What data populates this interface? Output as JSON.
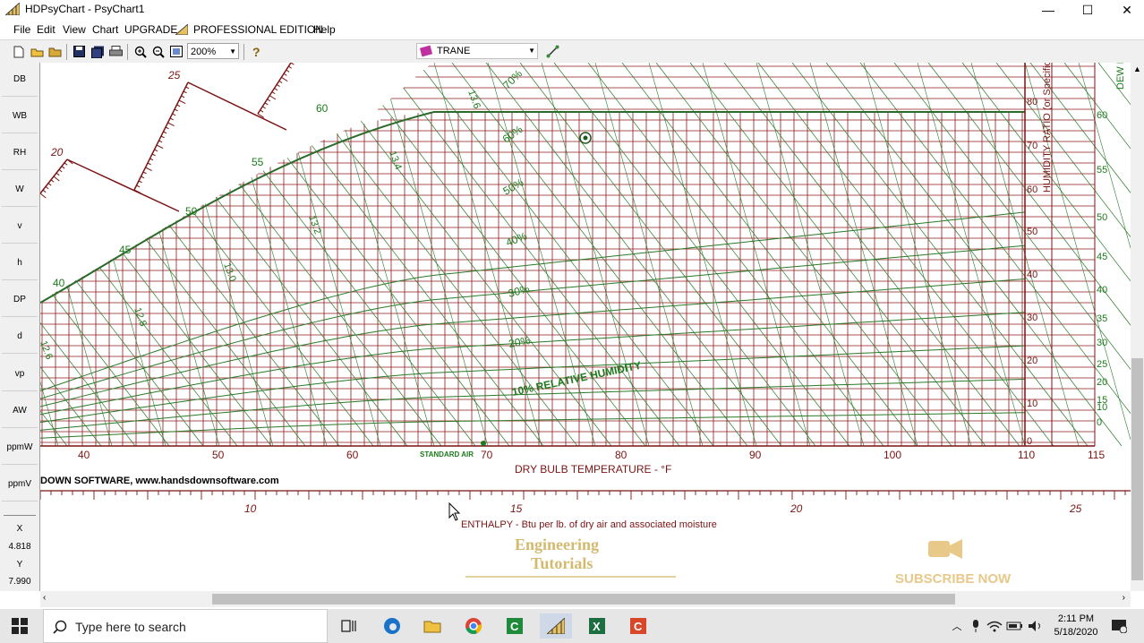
{
  "window": {
    "title": "HDPsyChart - PsyChart1",
    "minimize": "—",
    "maximize": "☐",
    "close": "✕"
  },
  "menu": [
    {
      "label": "File"
    },
    {
      "label": "Edit"
    },
    {
      "label": "View"
    },
    {
      "label": "Chart"
    },
    {
      "label": "UPGRADE"
    },
    {
      "label": "PROFESSIONAL EDITION"
    },
    {
      "label": "Help"
    }
  ],
  "toolbar": {
    "zoom": "200%",
    "brand": "TRANE"
  },
  "sidebar": [
    "DB",
    "WB",
    "RH",
    "W",
    "v",
    "h",
    "DP",
    "d",
    "vp",
    "AW",
    "ppmW",
    "ppmV"
  ],
  "readout": {
    "x_label": "X",
    "x_value": "4.818",
    "y_label": "Y",
    "y_value": "7.990"
  },
  "chart": {
    "x_ticks": [
      "40",
      "50",
      "60",
      "70",
      "80",
      "90",
      "100",
      "110",
      "115"
    ],
    "x_label": "DRY BULB TEMPERATURE - °F",
    "standard_air": "STANDARD AIR",
    "company": "DOWN SOFTWARE, www.handsdownsoftware.com",
    "enthalpy_ticks": [
      "10",
      "15",
      "20",
      "25"
    ],
    "enthalpy_label": "ENTHALPY - Btu per lb. of dry air and associated moisture",
    "hr_ticks": [
      "80",
      "70",
      "60",
      "50",
      "40",
      "30",
      "20",
      "10",
      "0"
    ],
    "hr_label": "HUMIDITY RATIO (or Specific Hum",
    "dp_ticks": [
      "60",
      "55",
      "50",
      "45",
      "40",
      "35",
      "30",
      "25",
      "20",
      "15",
      "10",
      "0"
    ],
    "dp_label": "DEW P",
    "rh_labels": [
      "70%",
      "60%",
      "50%",
      "40%",
      "30%",
      "20%",
      "10% RELATIVE HUMIDITY"
    ],
    "wb_labels": [
      "60",
      "55",
      "50",
      "45",
      "40"
    ],
    "volume_labels": [
      "13.6",
      "13.4",
      "13.2",
      "13.0",
      "12.8",
      "12.6"
    ],
    "enthalpy_scale_labels": [
      "25",
      "20"
    ],
    "watermark_1": "Engineering",
    "watermark_2": "Tutorials",
    "subscribe": "SUBSCRIBE NOW"
  },
  "taskbar": {
    "search_placeholder": "Type here to search",
    "time": "2:11 PM",
    "date": "5/18/2020"
  },
  "colors": {
    "grid_red": "#8b1a1a",
    "grid_green": "#2a7a2a",
    "chart_text": "#7a1414",
    "green_text": "#1e7a1e",
    "gold": "#c9a94a"
  }
}
